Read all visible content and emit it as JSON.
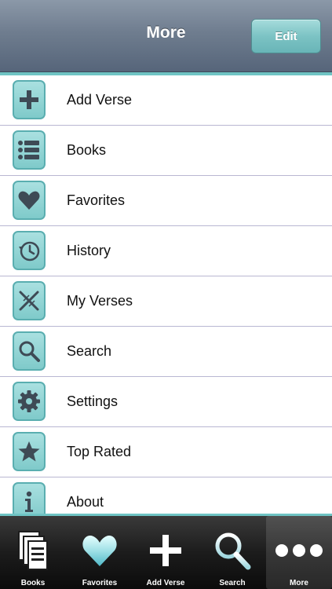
{
  "navbar": {
    "title": "More",
    "edit_label": "Edit"
  },
  "colors": {
    "accent": "#6fc4c4",
    "icon_tile": "#8fd3d3",
    "icon_glyph": "#3e4a55"
  },
  "menu": [
    {
      "label": "Add Verse",
      "icon": "plus-icon"
    },
    {
      "label": "Books",
      "icon": "list-icon"
    },
    {
      "label": "Favorites",
      "icon": "heart-icon"
    },
    {
      "label": "History",
      "icon": "history-clock-icon"
    },
    {
      "label": "My Verses",
      "icon": "crossed-pens-icon"
    },
    {
      "label": "Search",
      "icon": "magnifier-icon"
    },
    {
      "label": "Settings",
      "icon": "gear-icon"
    },
    {
      "label": "Top Rated",
      "icon": "star-icon"
    },
    {
      "label": "About",
      "icon": "info-icon"
    }
  ],
  "tabs": [
    {
      "label": "Books",
      "icon": "books-icon"
    },
    {
      "label": "Favorites",
      "icon": "heart-icon"
    },
    {
      "label": "Add Verse",
      "icon": "plus-icon"
    },
    {
      "label": "Search",
      "icon": "magnifier-icon"
    },
    {
      "label": "More",
      "icon": "more-dots-icon",
      "selected": true
    }
  ]
}
